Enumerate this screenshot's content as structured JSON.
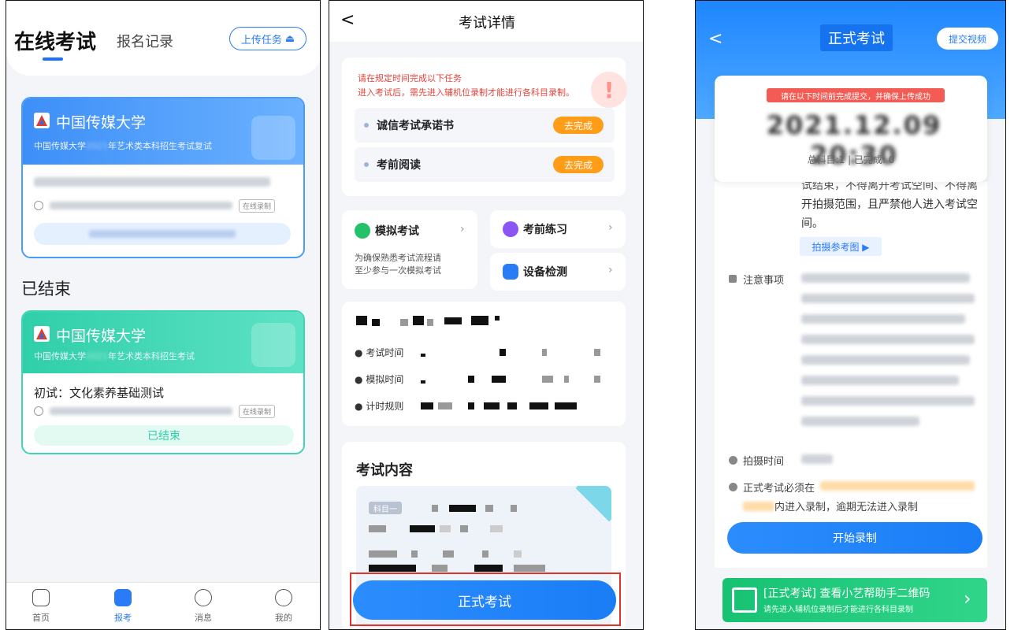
{
  "panel1": {
    "title": "在线考试",
    "tab_records": "报名记录",
    "upload_btn": "上传任务",
    "ended_section": "已结束",
    "card1": {
      "university": "中国传媒大学",
      "subtitle_prefix": "中国传媒大学",
      "subtitle_suffix": "年艺术类本科招生考试复试",
      "tag": "在线录制"
    },
    "card2": {
      "university": "中国传媒大学",
      "subtitle_prefix": "中国传媒大学",
      "subtitle_suffix": "年艺术类本科招生考试",
      "exam_name": "初试：文化素养基础测试",
      "tag": "在线录制",
      "status": "已结束"
    },
    "nav": [
      {
        "label": "首页",
        "icon": "home-icon"
      },
      {
        "label": "报考",
        "icon": "apply-icon"
      },
      {
        "label": "消息",
        "icon": "message-icon"
      },
      {
        "label": "我的",
        "icon": "profile-icon"
      }
    ]
  },
  "panel2": {
    "back": "<",
    "title": "考试详情",
    "notice_line1": "请在规定时间完成以下任务",
    "notice_line2": "进入考试后，需先进入辅机位录制才能进行各科目录制。",
    "tasks": [
      {
        "label": "诚信考试承诺书",
        "action": "去完成"
      },
      {
        "label": "考前阅读",
        "action": "去完成"
      }
    ],
    "mock_exam": {
      "title": "模拟考试",
      "desc_line1": "为确保熟悉考试流程请",
      "desc_line2": "至少参与一次模拟考试"
    },
    "practice": "考前练习",
    "device_check": "设备检测",
    "info_rows": [
      "考试时间",
      "模拟时间",
      "计时规则"
    ],
    "content_title": "考试内容",
    "subject_tag": "科目一",
    "formal_btn": "正式考试"
  },
  "panel3": {
    "back": "<",
    "title": "正式考试",
    "submit_video": "提交视频",
    "red_tag": "请在以下时间前完成提交，并确保上传成功",
    "deadline": "2021.12.09 20:30",
    "totals": "总科目:1 | 已完成: 0",
    "text_line1": "试结束，不得离开考试空间、不得离",
    "text_line2": "开拍摄范围，且严禁他人进入考试空",
    "text_line3": "间。",
    "ref_btn": "拍摄参考图 ▶",
    "notice_label": "注意事项",
    "shoot_time_label": "拍摄时间",
    "must_label": "正式考试必须在",
    "must_line2": "内进入录制，逾期无法进入录制",
    "start_btn": "开始录制",
    "qr_title": "[正式考试] 查看小艺帮助手二维码",
    "qr_sub": "请先进入辅机位录制后才能进行各科目录制"
  }
}
